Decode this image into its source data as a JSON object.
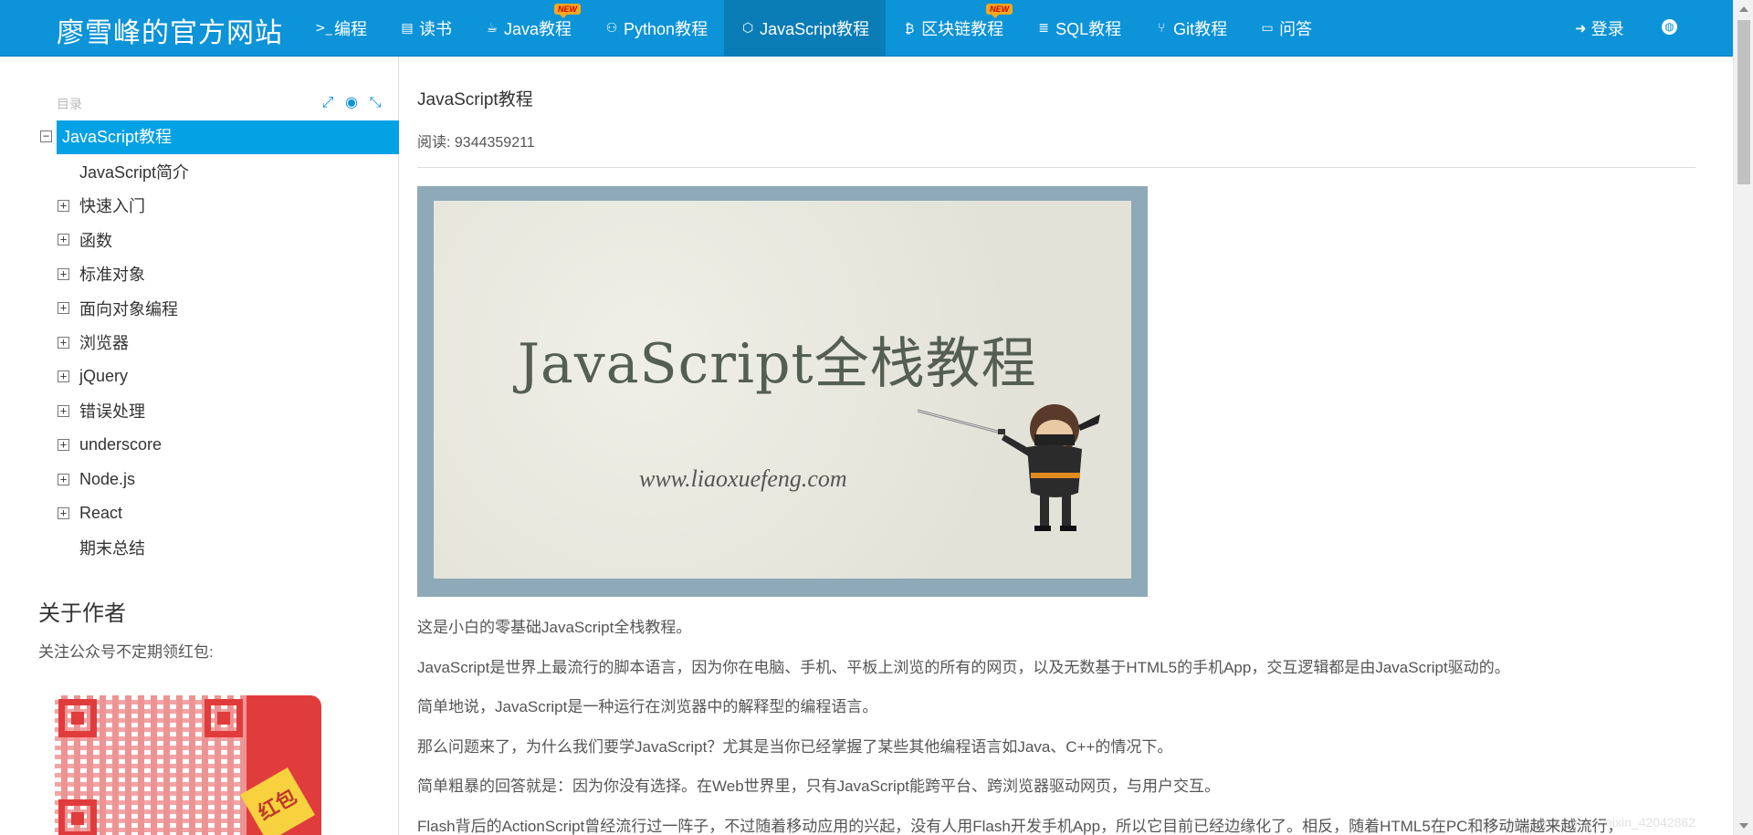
{
  "brand": "廖雪峰的官方网站",
  "nav": [
    {
      "icon": "terminal-icon",
      "glyph": ">_",
      "label": "编程",
      "badge": ""
    },
    {
      "icon": "book-icon",
      "glyph": "▤",
      "label": "读书",
      "badge": ""
    },
    {
      "icon": "coffee-icon",
      "glyph": "☕",
      "label": "Java教程",
      "badge": "NEW"
    },
    {
      "icon": "python-icon",
      "glyph": "⚇",
      "label": "Python教程",
      "badge": ""
    },
    {
      "icon": "hexagon-icon",
      "glyph": "⬡",
      "label": "JavaScript教程",
      "badge": ""
    },
    {
      "icon": "bitcoin-icon",
      "glyph": "₿",
      "label": "区块链教程",
      "badge": "NEW"
    },
    {
      "icon": "database-icon",
      "glyph": "≣",
      "label": "SQL教程",
      "badge": ""
    },
    {
      "icon": "git-branch-icon",
      "glyph": "⑂",
      "label": "Git教程",
      "badge": ""
    },
    {
      "icon": "comment-icon",
      "glyph": "▭",
      "label": "问答",
      "badge": ""
    }
  ],
  "login": {
    "label": "登录",
    "glyph": "➜"
  },
  "globe_glyph": "◍",
  "sidebar": {
    "toc_heading": "目录",
    "tools": {
      "expand": "⤢",
      "locate": "◉",
      "collapse": "⤡"
    },
    "root": {
      "label": "JavaScript教程",
      "toggle": "−"
    },
    "items": [
      {
        "label": "JavaScript简介",
        "toggle": ""
      },
      {
        "label": "快速入门",
        "toggle": "+"
      },
      {
        "label": "函数",
        "toggle": "+"
      },
      {
        "label": "标准对象",
        "toggle": "+"
      },
      {
        "label": "面向对象编程",
        "toggle": "+"
      },
      {
        "label": "浏览器",
        "toggle": "+"
      },
      {
        "label": "jQuery",
        "toggle": "+"
      },
      {
        "label": "错误处理",
        "toggle": "+"
      },
      {
        "label": "underscore",
        "toggle": "+"
      },
      {
        "label": "Node.js",
        "toggle": "+"
      },
      {
        "label": "React",
        "toggle": "+"
      },
      {
        "label": "期末总结",
        "toggle": ""
      }
    ],
    "about_title": "关于作者",
    "about_text": "关注公众号不定期领红包:",
    "qr_tag": "红包"
  },
  "main": {
    "title": "JavaScript教程",
    "reads_label": "阅读: ",
    "reads_value": "9344359211",
    "banner_title": "JavaScript全栈教程",
    "banner_url": "www.liaoxuefeng.com",
    "paragraphs": [
      "这是小白的零基础JavaScript全栈教程。",
      "JavaScript是世界上最流行的脚本语言，因为你在电脑、手机、平板上浏览的所有的网页，以及无数基于HTML5的手机App，交互逻辑都是由JavaScript驱动的。",
      "简单地说，JavaScript是一种运行在浏览器中的解释型的编程语言。",
      "那么问题来了，为什么我们要学JavaScript？尤其是当你已经掌握了某些其他编程语言如Java、C++的情况下。",
      "简单粗暴的回答就是：因为你没有选择。在Web世界里，只有JavaScript能跨平台、跨浏览器驱动网页，与用户交互。",
      "Flash背后的ActionScript曾经流行过一阵子，不过随着移动应用的兴起，没有人用Flash开发手机App，所以它目前已经边缘化了。相反，随着HTML5在PC和移动端越来越流行，"
    ],
    "watermark": "https://blog.csdn.net/weixin_42042862"
  }
}
